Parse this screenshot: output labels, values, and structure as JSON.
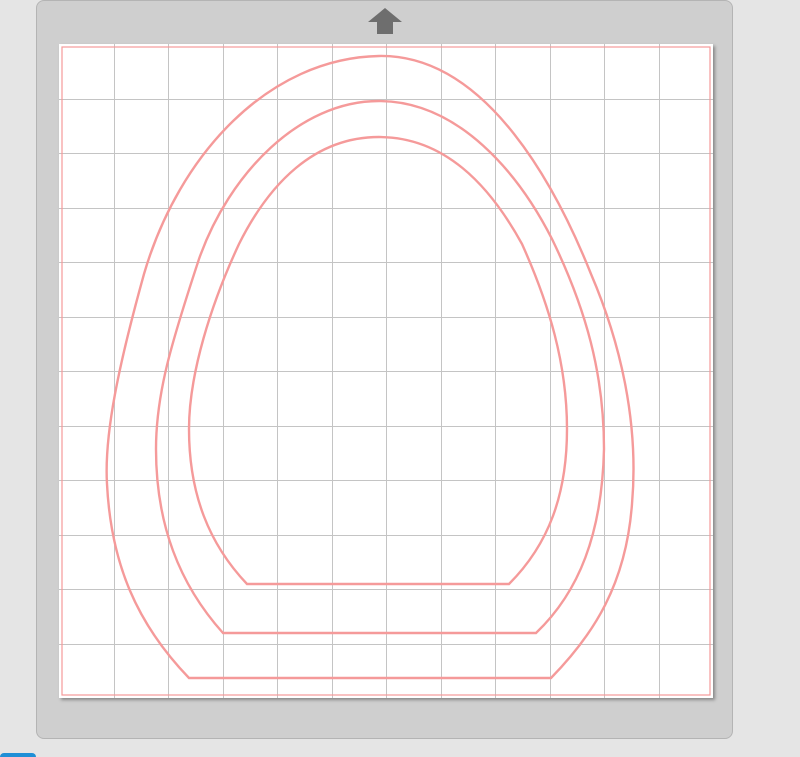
{
  "colors": {
    "background": "#e5e5e5",
    "mat_frame": "#cfcfcf",
    "mat_surface": "#ffffff",
    "grid_line": "#c4c4c4",
    "cut_line": "#f59a9a",
    "feed_arrow": "#6e6e6e",
    "accent": "#1f8fd6"
  },
  "icons": {
    "feed_arrow": "arrow-up-icon"
  },
  "mat": {
    "grid_columns": 12,
    "grid_rows": 12
  },
  "canvas": {
    "shapes": [
      {
        "name": "outer-egg-outline",
        "type": "arched-egg"
      },
      {
        "name": "middle-egg-outline",
        "type": "arched-egg"
      },
      {
        "name": "inner-egg-outline",
        "type": "arched-egg"
      }
    ]
  }
}
